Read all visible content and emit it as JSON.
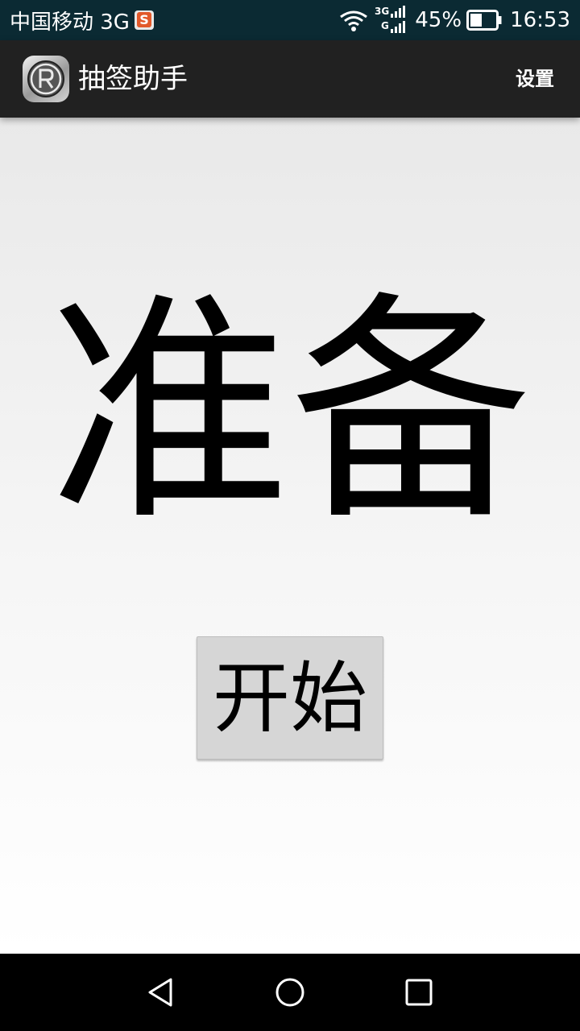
{
  "status_bar": {
    "carrier": "中国移动 3G",
    "battery_percent": "45%",
    "time": "16:53",
    "network_label_top": "3G",
    "network_label_bottom": "G",
    "icons": [
      "sohu-icon",
      "wifi-icon",
      "signal-icon",
      "battery-icon"
    ],
    "battery_level": 0.45
  },
  "action_bar": {
    "app_title": "抽签助手",
    "settings_label": "设置",
    "app_icon": "registered-trademark-icon"
  },
  "main": {
    "result_text": "准备",
    "start_button_label": "开始"
  },
  "nav_bar": {
    "icons": [
      "back-icon",
      "home-icon",
      "recent-apps-icon"
    ]
  },
  "colors": {
    "status_bar_bg": "#0b2a33",
    "action_bar_bg": "#212121",
    "button_bg": "#d6d6d6",
    "nav_bar_bg": "#000000"
  }
}
